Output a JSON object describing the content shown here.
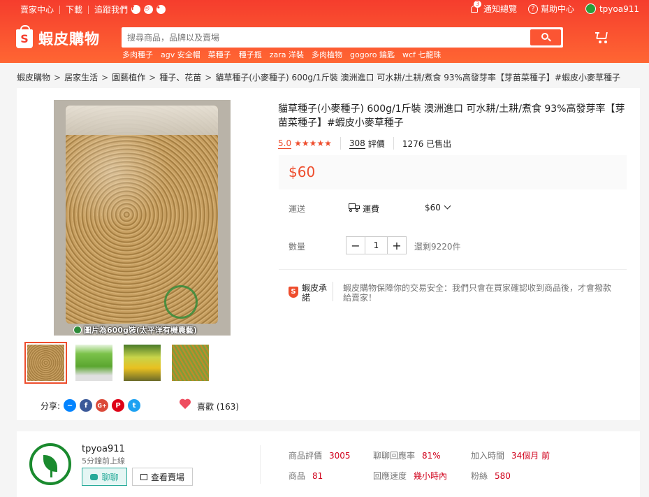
{
  "topbar": {
    "seller_center": "賣家中心",
    "download": "下載",
    "follow_us": "追蹤我們",
    "notifications_label": "通知總覽",
    "notifications_badge": "3",
    "help": "幫助中心",
    "username": "tpyoa911"
  },
  "header": {
    "brand": "蝦皮購物",
    "search_placeholder": "搜尋商品，品牌以及賣場",
    "hints": [
      "多肉種子",
      "agv 安全帽",
      "菜種子",
      "種子瓶",
      "zara 洋裝",
      "多肉植物",
      "gogoro 鑰匙",
      "wcf 七龍珠"
    ]
  },
  "breadcrumb": [
    "蝦皮購物",
    "居家生活",
    "園藝植作",
    "種子、花苗",
    "貓草種子(小麥種子) 600g/1斤裝 澳洲進口 可水耕/土耕/煮食 93%高發芽率【芽苗菜種子】#蝦皮小麥草種子"
  ],
  "gallery": {
    "main_caption": "圖片為600g裝(太平洋有機農藝)",
    "thumbnail_count": 4
  },
  "share": {
    "label": "分享:",
    "likes": "喜歡 (163)"
  },
  "product": {
    "title": "貓草種子(小麥種子) 600g/1斤裝 澳洲進口 可水耕/土耕/煮食 93%高發芽率【芽苗菜種子】#蝦皮小麥草種子",
    "rating_score": "5.0",
    "stars": "★★★★★",
    "rating_count": "308",
    "rating_label": "評價",
    "sold": "1276 已售出",
    "price": "$60",
    "shipping_label": "運送",
    "shipping_fee_label": "運費",
    "shipping_fee_value": "$60",
    "quantity_label": "數量",
    "quantity_value": "1",
    "stock": "還剩9220件",
    "guarantee_title": "蝦皮承諾",
    "guarantee_text": "蝦皮購物保障你的交易安全：我們只會在買家確認收到商品後，才會撥款給賣家！"
  },
  "seller": {
    "name": "tpyoa911",
    "active": "5分鐘前上線",
    "chat_label": "聊聊",
    "view_shop_label": "查看賣場",
    "stats": [
      {
        "label": "商品評價",
        "value": "3005"
      },
      {
        "label": "聊聊回應率",
        "value": "81%"
      },
      {
        "label": "加入時間",
        "value": "34個月 前"
      },
      {
        "label": "商品",
        "value": "81"
      },
      {
        "label": "回應速度",
        "value": "幾小時內"
      },
      {
        "label": "粉絲",
        "value": "580"
      }
    ]
  },
  "colors": {
    "brand": "#ee4d2d",
    "header_gradient_start": "#f53d2d",
    "header_gradient_end": "#ff6633",
    "chat": "#26aa99"
  }
}
